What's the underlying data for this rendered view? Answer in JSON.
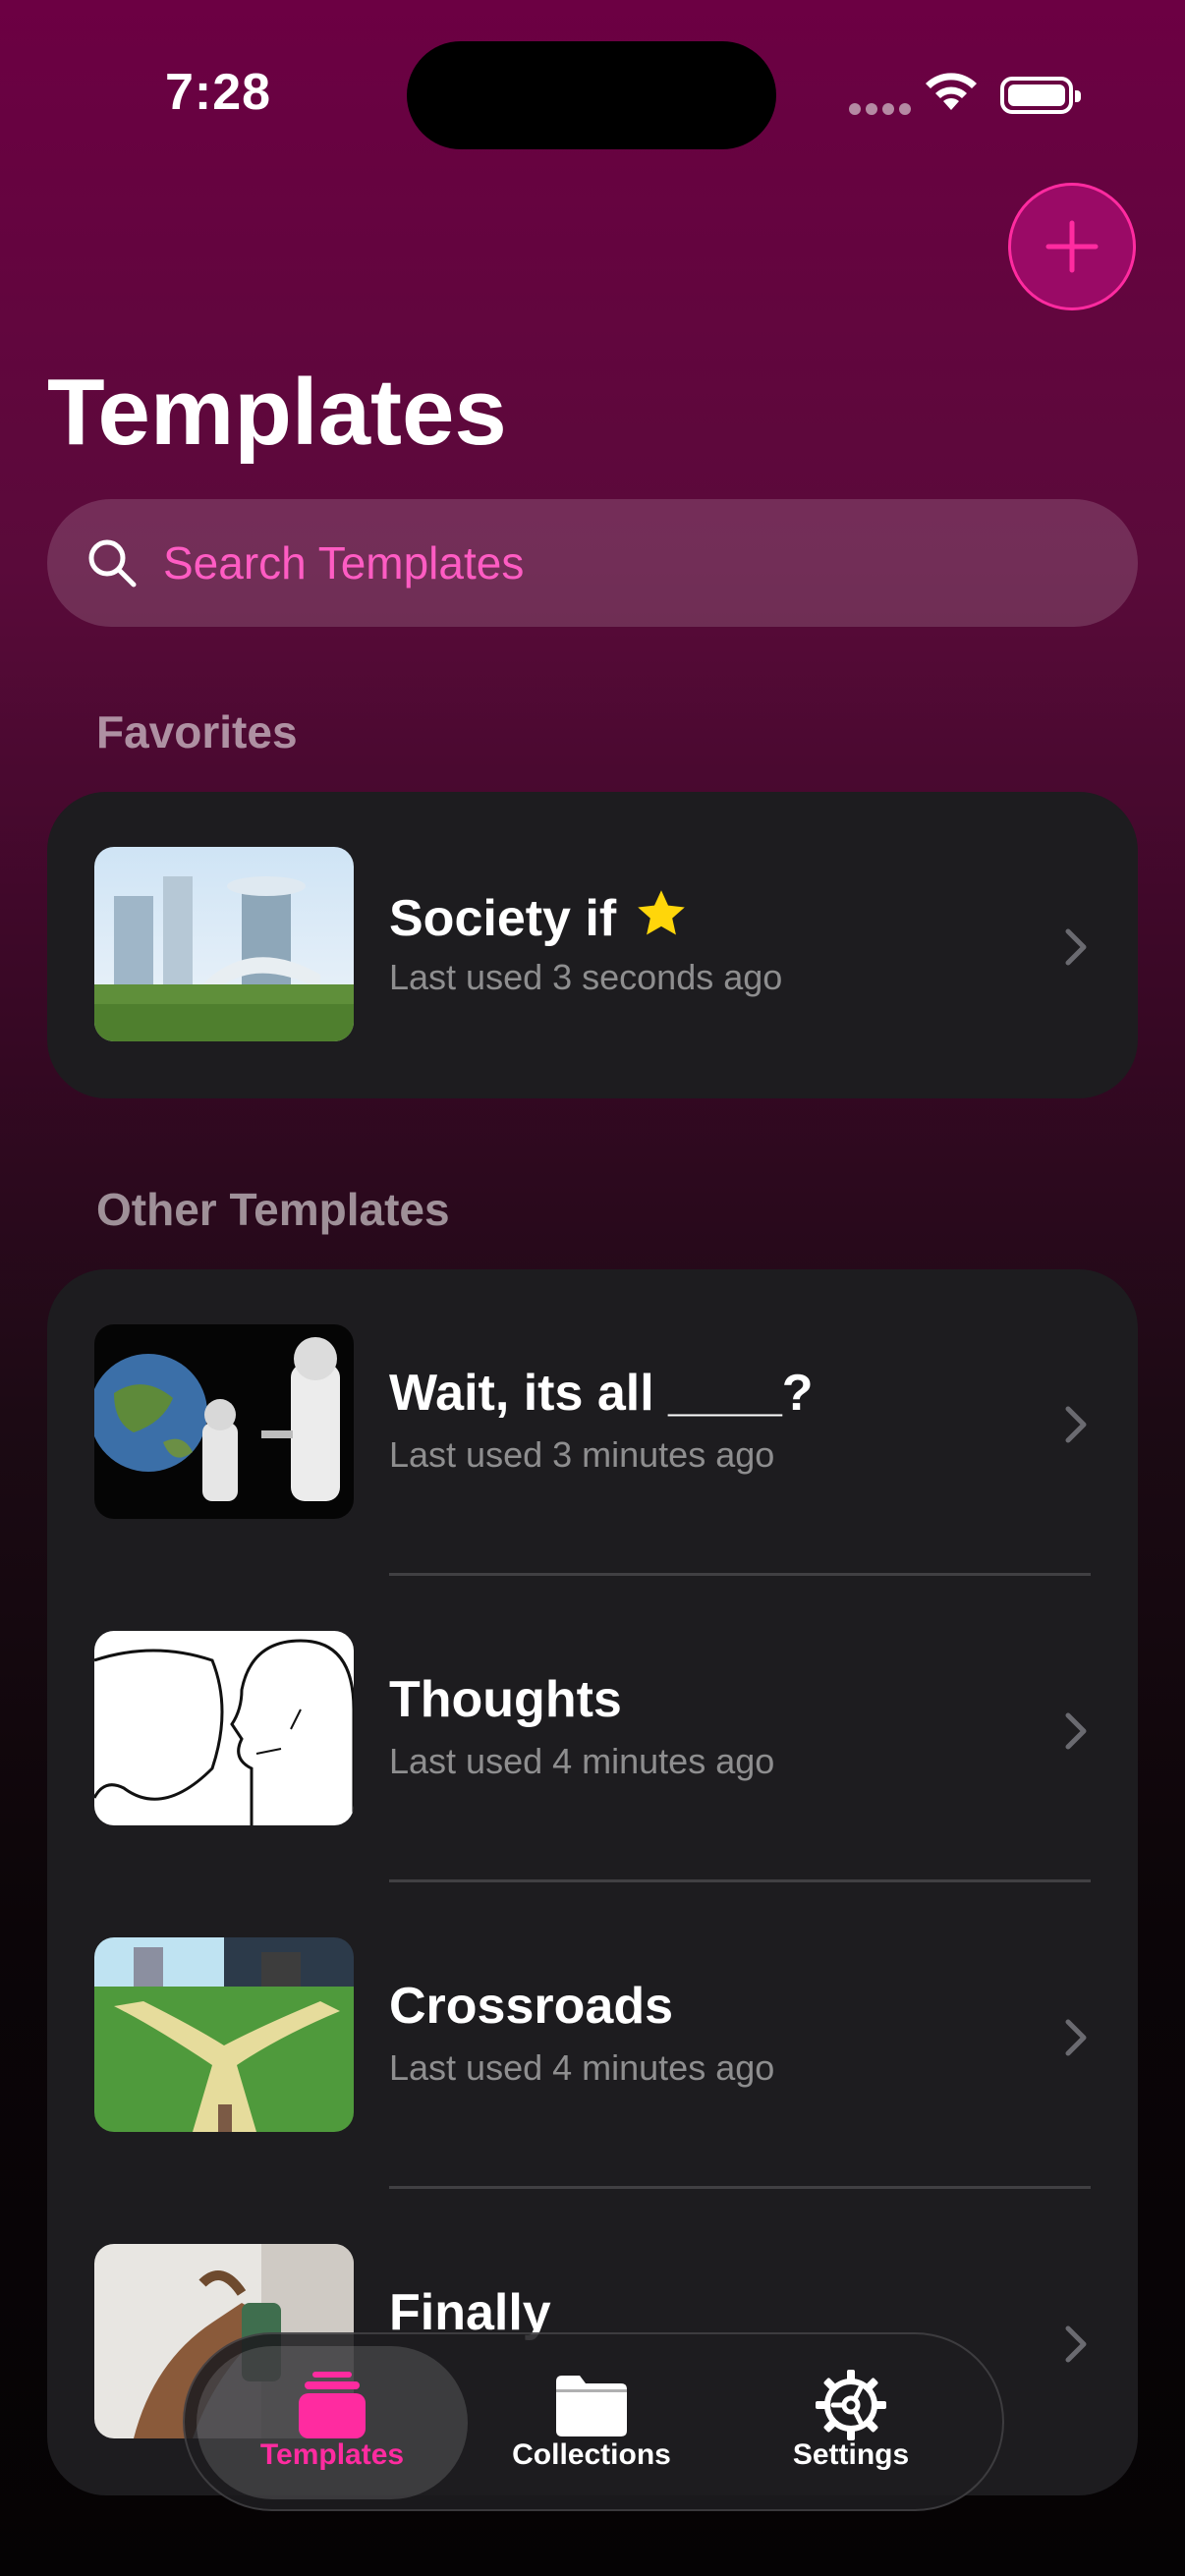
{
  "status": {
    "time": "7:28"
  },
  "header": {
    "title": "Templates"
  },
  "search": {
    "placeholder": "Search Templates"
  },
  "favorites": {
    "label": "Favorites",
    "items": [
      {
        "title": "Society if",
        "subtitle": "Last used 3 seconds ago",
        "starred": true
      }
    ]
  },
  "other": {
    "label": "Other Templates",
    "items": [
      {
        "title": "Wait, its all ____?",
        "subtitle": "Last used 3 minutes ago"
      },
      {
        "title": "Thoughts",
        "subtitle": "Last used 4 minutes ago"
      },
      {
        "title": "Crossroads",
        "subtitle": "Last used 4 minutes ago"
      },
      {
        "title": "Finally",
        "subtitle": ""
      }
    ]
  },
  "tabbar": {
    "tabs": [
      {
        "label": "Templates",
        "icon": "templates-stack-icon",
        "active": true
      },
      {
        "label": "Collections",
        "icon": "folder-icon",
        "active": false
      },
      {
        "label": "Settings",
        "icon": "gear-icon",
        "active": false
      }
    ]
  },
  "colors": {
    "accent": "#ff2ba0",
    "card": "#1d1c1f",
    "star": "#ffd60a"
  }
}
